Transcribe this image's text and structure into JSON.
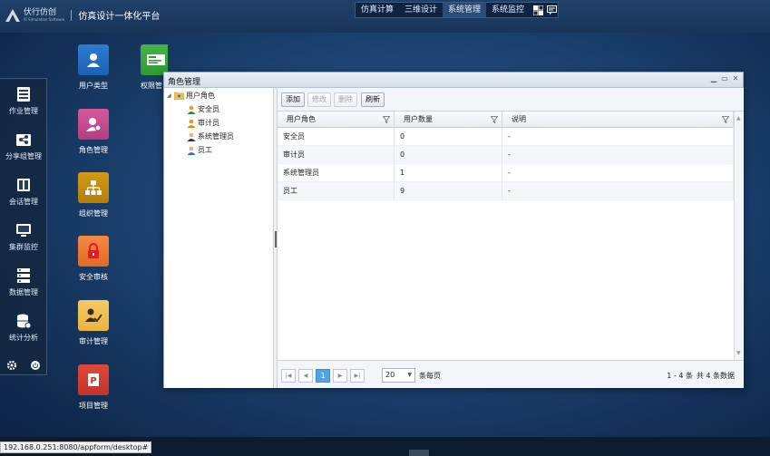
{
  "header": {
    "brand": "伏行仿创",
    "brand_sub": "Xi Simulation Software",
    "platform_title": "仿真设计一体化平台",
    "nav": [
      {
        "label": "仿真计算",
        "active": false
      },
      {
        "label": "三维设计",
        "active": false
      },
      {
        "label": "系统管理",
        "active": true
      },
      {
        "label": "系统监控",
        "active": false
      }
    ]
  },
  "dock": {
    "items": [
      {
        "label": "作业管理",
        "icon": "list-icon"
      },
      {
        "label": "分享组管理",
        "icon": "share-group-icon"
      },
      {
        "label": "会话管理",
        "icon": "session-icon"
      },
      {
        "label": "集群监控",
        "icon": "monitor-icon"
      },
      {
        "label": "数据管理",
        "icon": "data-icon"
      },
      {
        "label": "统计分析",
        "icon": "database-icon"
      }
    ]
  },
  "desktop": {
    "icons": [
      {
        "label": "用户类型",
        "icon": "user-type-icon"
      },
      {
        "label": "角色管理",
        "icon": "role-management-icon"
      },
      {
        "label": "组织管理",
        "icon": "org-chart-icon"
      },
      {
        "label": "安全审核",
        "icon": "lock-icon"
      },
      {
        "label": "审计管理",
        "icon": "audit-icon"
      },
      {
        "label": "项目管理",
        "icon": "project-icon"
      },
      {
        "label": "权限管",
        "icon": "permission-icon"
      }
    ]
  },
  "window": {
    "title": "角色管理",
    "tree": {
      "root": "用户角色",
      "children": [
        "安全员",
        "审计员",
        "系统管理员",
        "员工"
      ]
    },
    "toolbar": {
      "add": "添加",
      "edit": "修改",
      "delete": "删除",
      "refresh": "刷新"
    },
    "grid": {
      "columns": [
        "用户角色",
        "用户数量",
        "说明"
      ],
      "rows": [
        {
          "role": "安全员",
          "count": "0",
          "desc": "-"
        },
        {
          "role": "审计员",
          "count": "0",
          "desc": "-"
        },
        {
          "role": "系统管理员",
          "count": "1",
          "desc": "-"
        },
        {
          "role": "员工",
          "count": "9",
          "desc": "-"
        }
      ]
    },
    "pager": {
      "current_page": "1",
      "page_size": "20",
      "page_size_label": "条每页",
      "range": "1 - 4 条",
      "total": "共 4 条数据"
    }
  },
  "status_url": "192.168.0.251:8080/appform/desktop#"
}
